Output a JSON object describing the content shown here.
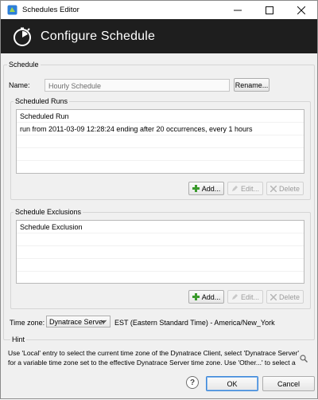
{
  "window": {
    "title": "Schedules Editor"
  },
  "header": {
    "title": "Configure Schedule"
  },
  "schedule": {
    "legend": "Schedule",
    "name_label": "Name:",
    "name_value": "Hourly Schedule",
    "rename_label": "Rename..."
  },
  "runs": {
    "legend": "Scheduled Runs",
    "items": [
      "Scheduled Run",
      "run from 2011-03-09 12:28:24 ending after 20 occurrences, every 1 hours"
    ],
    "add_label": "Add...",
    "edit_label": "Edit...",
    "delete_label": "Delete"
  },
  "exclusions": {
    "legend": "Schedule Exclusions",
    "items": [
      "Schedule Exclusion"
    ],
    "add_label": "Add...",
    "edit_label": "Edit...",
    "delete_label": "Delete"
  },
  "timezone": {
    "label": "Time zone:",
    "selected": "Dynatrace Server",
    "description": "EST (Eastern Standard Time) - America/New_York"
  },
  "hint": {
    "legend": "Hint",
    "line1": "Use 'Local' entry to select the current time zone of the Dynatrace Client, select 'Dynatrace Server'",
    "line2": "for a variable time zone set to the effective Dynatrace Server time zone. Use 'Other...' to select a"
  },
  "footer": {
    "help_icon": "?",
    "ok_label": "OK",
    "cancel_label": "Cancel"
  },
  "colors": {
    "banner": "#1e1e1e",
    "accent": "#3b86d8"
  }
}
